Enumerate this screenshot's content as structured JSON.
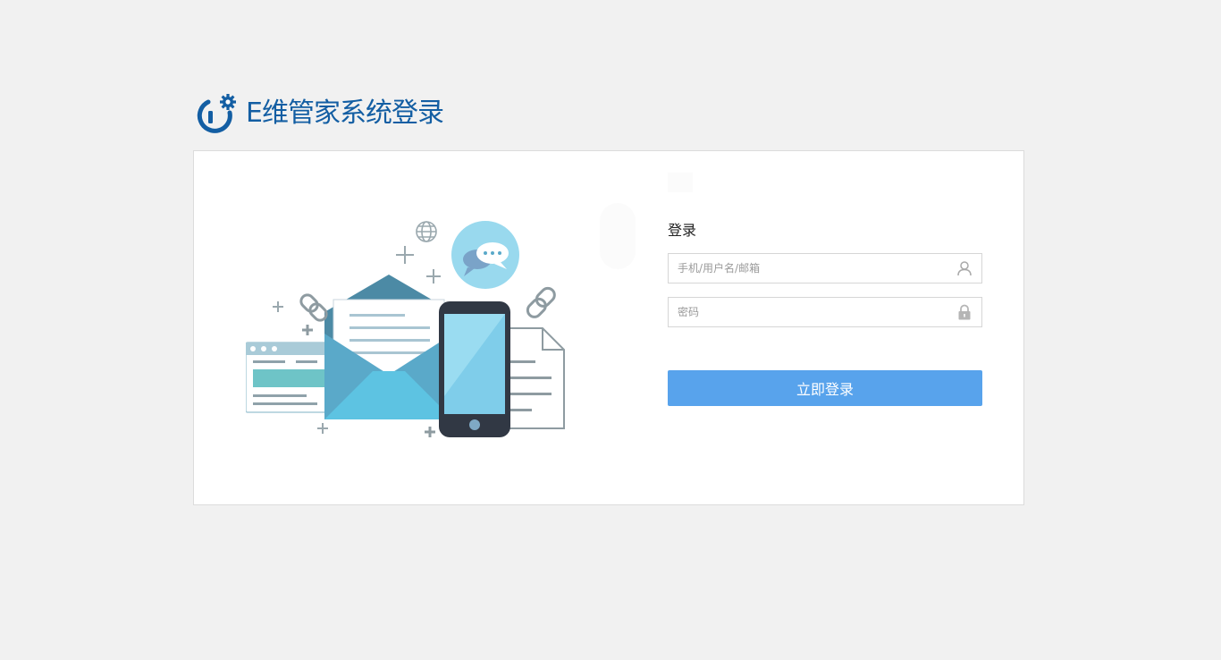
{
  "brand": {
    "title": "E维管家系统登录",
    "logo_icon": "power-gear-icon",
    "color": "#135ea3"
  },
  "login": {
    "heading": "登录",
    "username": {
      "placeholder": "手机/用户名/邮箱",
      "value": "",
      "icon": "user-icon"
    },
    "password": {
      "placeholder": "密码",
      "value": "",
      "icon": "lock-icon"
    },
    "submit_label": "立即登录",
    "button_color": "#58a3ec"
  },
  "illustration": {
    "name": "mail-phone-illustration"
  }
}
